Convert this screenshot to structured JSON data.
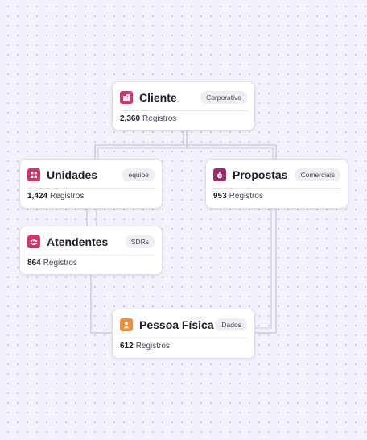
{
  "nodes": {
    "cliente": {
      "title": "Cliente",
      "tag": "Corporativo",
      "count": "2,360",
      "unit": "Registros",
      "color": "#d6336c",
      "icon": "building-icon"
    },
    "unidades": {
      "title": "Unidades",
      "tag": "equipe",
      "count": "1,424",
      "unit": "Registros",
      "color": "#d6336c",
      "icon": "grid-icon"
    },
    "propostas": {
      "title": "Propostas",
      "tag": "Comerciais",
      "count": "953",
      "unit": "Registros",
      "color": "#9b2c6b",
      "icon": "money-bag-icon"
    },
    "atendentes": {
      "title": "Atendentes",
      "tag": "SDRs",
      "count": "864",
      "unit": "Registros",
      "color": "#d6336c",
      "icon": "group-icon"
    },
    "pessoa": {
      "title": "Pessoa Física",
      "tag": "Dados",
      "count": "612",
      "unit": "Registros",
      "color": "#f08c3a",
      "icon": "person-icon"
    }
  },
  "colors": {
    "background": "#f3f1fb",
    "connector": "#c9c5d6"
  }
}
